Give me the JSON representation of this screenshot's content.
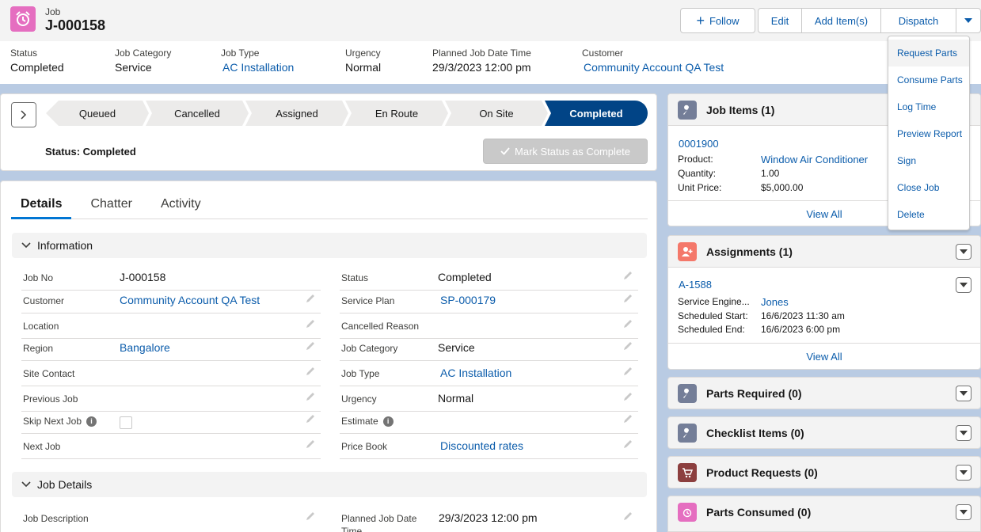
{
  "colors": {
    "brand": "#0176d3",
    "link": "#0b5cab",
    "path_active": "#014486",
    "job_icon": "#e56ec0"
  },
  "header": {
    "object_label": "Job",
    "record_name": "J-000158",
    "follow_label": "Follow",
    "actions": [
      "Edit",
      "Add Item(s)",
      "Dispatch"
    ],
    "fields": [
      {
        "label": "Status",
        "value": "Completed",
        "link": false
      },
      {
        "label": "Job Category",
        "value": "Service",
        "link": false
      },
      {
        "label": "Job Type",
        "value": "AC Installation",
        "link": true
      },
      {
        "label": "Urgency",
        "value": "Normal",
        "link": false
      },
      {
        "label": "Planned Job Date Time",
        "value": "29/3/2023 12:00 pm",
        "link": false
      },
      {
        "label": "Customer",
        "value": "Community Account QA Test",
        "link": true
      }
    ]
  },
  "path": {
    "stages": [
      "Queued",
      "Cancelled",
      "Assigned",
      "En Route",
      "On Site",
      "Completed"
    ],
    "current": "Completed",
    "status_text": "Status: Completed",
    "mark_button": "Mark Status as Complete"
  },
  "tabs": [
    "Details",
    "Chatter",
    "Activity"
  ],
  "information": {
    "title": "Information",
    "left": [
      {
        "label": "Job No",
        "value": "J-000158",
        "link": false
      },
      {
        "label": "Customer",
        "value": "Community Account QA Test",
        "link": true
      },
      {
        "label": "Location",
        "value": "",
        "link": false
      },
      {
        "label": "Region",
        "value": "Bangalore",
        "link": true
      },
      {
        "label": "Site Contact",
        "value": "",
        "link": false
      },
      {
        "label": "Previous Job",
        "value": "",
        "link": false
      },
      {
        "label": "Skip Next Job",
        "value": "",
        "link": false
      },
      {
        "label": "Next Job",
        "value": "",
        "link": false
      }
    ],
    "right": [
      {
        "label": "Status",
        "value": "Completed",
        "link": false
      },
      {
        "label": "Service Plan",
        "value": "SP-000179",
        "link": true
      },
      {
        "label": "Cancelled Reason",
        "value": "",
        "link": false
      },
      {
        "label": "Job Category",
        "value": "Service",
        "link": false
      },
      {
        "label": "Job Type",
        "value": "AC Installation",
        "link": true
      },
      {
        "label": "Urgency",
        "value": "Normal",
        "link": false
      },
      {
        "label": "Estimate",
        "value": "",
        "link": false
      },
      {
        "label": "Price Book",
        "value": "Discounted rates",
        "link": true
      }
    ]
  },
  "job_details": {
    "title": "Job Details",
    "left_label": "Job Description",
    "right_label_1": "Planned Job Date",
    "right_label_2": "Time",
    "right_value": "29/3/2023 12:00 pm"
  },
  "related": {
    "job_items": {
      "title": "Job Items (1)",
      "record": "0001900",
      "fields": [
        {
          "k": "Product:",
          "v": "Window Air Conditioner"
        },
        {
          "k": "Quantity:",
          "v": "1.00"
        },
        {
          "k": "Unit Price:",
          "v": "$5,000.00"
        }
      ],
      "view_all": "View All"
    },
    "assignments": {
      "title": "Assignments (1)",
      "record": "A-1588",
      "fields": [
        {
          "k": "Service Engine...",
          "v": "Jones"
        },
        {
          "k": "Scheduled Start:",
          "v": "16/6/2023 11:30 am"
        },
        {
          "k": "Scheduled End:",
          "v": "16/6/2023 6:00 pm"
        }
      ],
      "view_all": "View All"
    },
    "parts_required": "Parts Required (0)",
    "checklist_items": "Checklist Items (0)",
    "product_requests": "Product Requests (0)",
    "parts_consumed": "Parts Consumed (0)"
  },
  "menu": [
    "Request Parts",
    "Consume Parts",
    "Log Time",
    "Preview Report",
    "Sign",
    "Close Job",
    "Delete"
  ]
}
